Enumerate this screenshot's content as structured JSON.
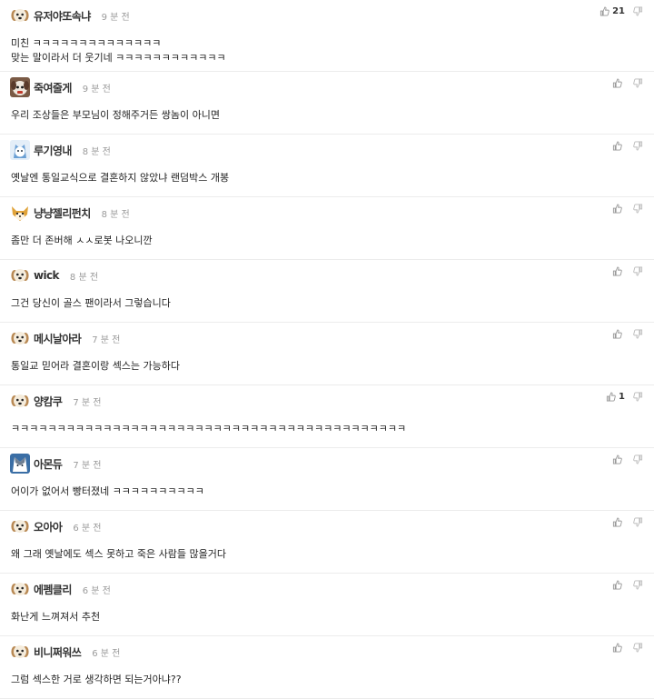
{
  "comments": [
    {
      "nick": "유저야또속냐",
      "time": "9 분 전",
      "lines": [
        "미친 ㅋㅋㅋㅋㅋㅋㅋㅋㅋㅋㅋㅋㅋㅋ",
        "맞는 말이라서 더 웃기네 ㅋㅋㅋㅋㅋㅋㅋㅋㅋㅋㅋㅋ"
      ],
      "likes": "21",
      "avatar": "puppy"
    },
    {
      "nick": "죽여줄게",
      "time": "9 분 전",
      "lines": [
        "우리 조상들은 부모님이 정해주거든 쌍놈이 아니면"
      ],
      "likes": "",
      "avatar": "dog-photo"
    },
    {
      "nick": "루기영내",
      "time": "8 분 전",
      "lines": [
        "옛날엔 통일교식으로 결혼하지 않았냐 랜덤박스 개봉"
      ],
      "likes": "",
      "avatar": "blue-dog"
    },
    {
      "nick": "냥냥젤리펀치",
      "time": "8 분 전",
      "lines": [
        "좀만 더 존버해 ㅅㅅ로봇 나오니깐"
      ],
      "likes": "",
      "avatar": "shiba"
    },
    {
      "nick": "wick",
      "time": "8 분 전",
      "lines": [
        "그건 당신이 골스 팬이라서 그렇습니다"
      ],
      "likes": "",
      "avatar": "puppy"
    },
    {
      "nick": "메시날아라",
      "time": "7 분 전",
      "lines": [
        "통일교 믿어라 결혼이랑 섹스는 가능하다"
      ],
      "likes": "",
      "avatar": "puppy"
    },
    {
      "nick": "양캄쿠",
      "time": "7 분 전",
      "lines": [
        "ㅋㅋㅋㅋㅋㅋㅋㅋㅋㅋㅋㅋㅋㅋㅋㅋㅋㅋㅋㅋㅋㅋㅋㅋㅋㅋㅋㅋㅋㅋㅋㅋㅋㅋㅋㅋㅋㅋㅋㅋㅋㅋㅋ"
      ],
      "likes": "1",
      "avatar": "puppy"
    },
    {
      "nick": "아몬듀",
      "time": "7 분 전",
      "lines": [
        "어이가 없어서 빵터졌네 ㅋㅋㅋㅋㅋㅋㅋㅋㅋㅋ"
      ],
      "likes": "",
      "avatar": "husky"
    },
    {
      "nick": "오아아",
      "time": "6 분 전",
      "lines": [
        "왜 그래 옛날에도 섹스 못하고 죽은 사람들 많을거다"
      ],
      "likes": "",
      "avatar": "puppy"
    },
    {
      "nick": "에펨클리",
      "time": "6 분 전",
      "lines": [
        "화난게 느껴져서 추천"
      ],
      "likes": "",
      "avatar": "puppy"
    },
    {
      "nick": "비니쩌워쓰",
      "time": "6 분 전",
      "lines": [
        "그럼 섹스한 거로 생각하면 되는거아냐??"
      ],
      "likes": "",
      "avatar": "puppy"
    }
  ],
  "colors": {
    "vote_icon": "#999999",
    "time": "#9a9a9a",
    "divider": "#ececec"
  },
  "icons": {
    "like": "thumbs-up-icon",
    "dislike": "thumbs-down-icon"
  }
}
